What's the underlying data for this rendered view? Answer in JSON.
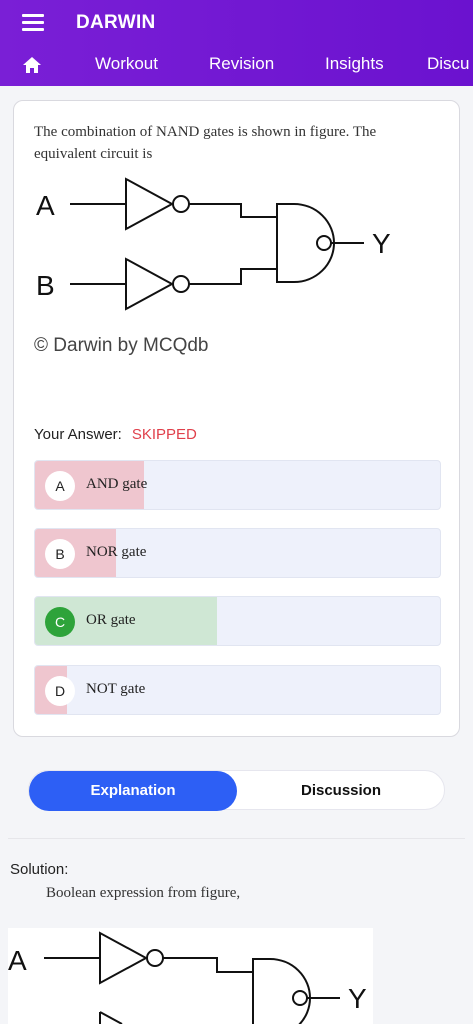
{
  "app": {
    "title": "DARWIN"
  },
  "nav": {
    "tabs": [
      "Workout",
      "Revision",
      "Insights",
      "Discu"
    ]
  },
  "question": {
    "text": "The combination of NAND gates is shown in figure. The equivalent circuit is",
    "figure": {
      "input_a": "A",
      "input_b": "B",
      "output": "Y",
      "watermark": "© Darwin by MCQdb"
    }
  },
  "answer": {
    "label": "Your Answer:",
    "status": "SKIPPED"
  },
  "options": [
    {
      "letter": "A",
      "text": "AND gate",
      "fill_fraction": 0.27,
      "fill_color": "#efc6cf",
      "correct": false
    },
    {
      "letter": "B",
      "text": "NOR gate",
      "fill_fraction": 0.2,
      "fill_color": "#efc6cf",
      "correct": false
    },
    {
      "letter": "C",
      "text": "OR gate",
      "fill_fraction": 0.45,
      "fill_color": "#cfe7d4",
      "correct": true
    },
    {
      "letter": "D",
      "text": "NOT gate",
      "fill_fraction": 0.08,
      "fill_color": "#efc6cf",
      "correct": false
    }
  ],
  "segment": {
    "explanation": "Explanation",
    "discussion": "Discussion"
  },
  "solution": {
    "title": "Solution:",
    "text": "Boolean expression from figure,",
    "figure": {
      "input_a": "A",
      "output": "Y"
    }
  }
}
